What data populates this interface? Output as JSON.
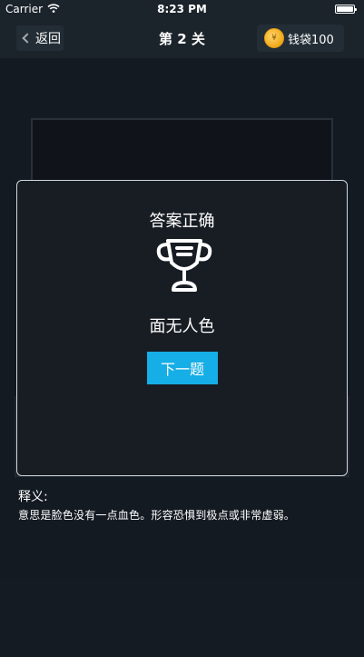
{
  "status_bar": {
    "carrier": "Carrier",
    "time": "8:23 PM",
    "battery_level": 1.0
  },
  "nav": {
    "back_label": "返回",
    "level_title": "第 2 关",
    "wallet_label": "钱袋100",
    "coin_symbol": "¥"
  },
  "dialog": {
    "title": "答案正确",
    "icon": "trophy-icon",
    "idiom": "面无人色",
    "next_label": "下一题"
  },
  "explanation": {
    "title": "释义:",
    "body": "意思是脸色没有一点血色。形容恐惧到极点或非常虚弱。"
  },
  "colors": {
    "background": "#1b232b",
    "dialog_background": "#171d23",
    "accent": "#16aee6",
    "coin": "#f0a81a"
  }
}
